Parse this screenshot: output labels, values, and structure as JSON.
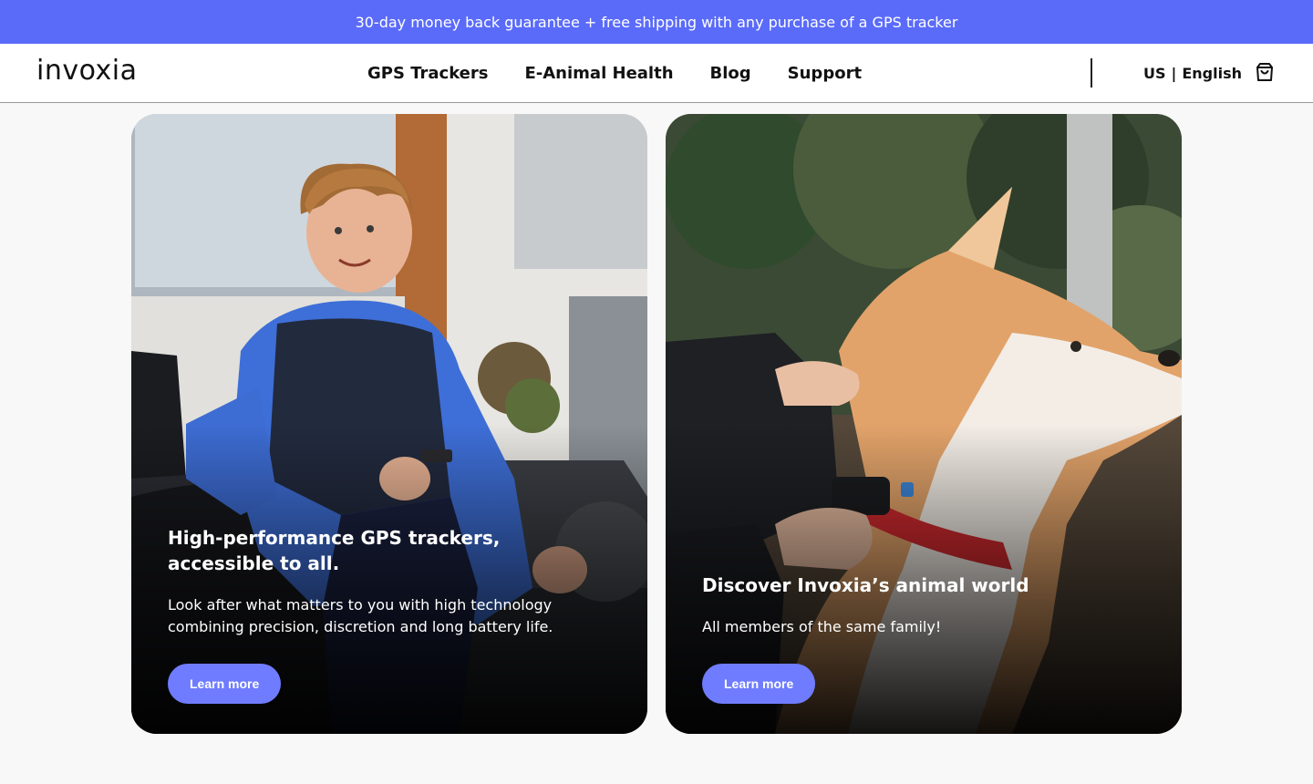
{
  "promo": {
    "text": "30-day money back guarantee + free shipping with any purchase of a GPS tracker"
  },
  "header": {
    "logo": "invoxia",
    "nav": [
      "GPS Trackers",
      "E-Animal Health",
      "Blog",
      "Support"
    ],
    "region": "US",
    "language": "English",
    "cart_icon": "shopping-bag-icon"
  },
  "cards": [
    {
      "title": "High-performance GPS trackers, accessible to all.",
      "description": "Look after what matters to you with high technology combining precision, discretion and long battery life.",
      "button": "Learn more"
    },
    {
      "title": "Discover Invoxia’s animal world",
      "description": "All members of the same family!",
      "button": "Learn more"
    }
  ],
  "colors": {
    "promo_bg": "#5a6bfa",
    "button_bg": "#6f7cff",
    "page_bg": "#f8f8f8"
  }
}
